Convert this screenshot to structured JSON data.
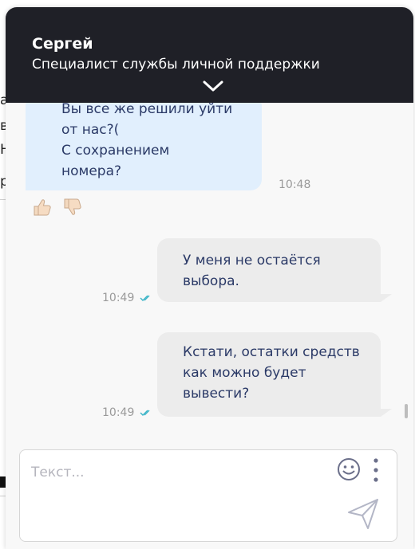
{
  "header": {
    "agent_name": "Сергей",
    "agent_role": "Специалист службы личной поддержки"
  },
  "background_page": {
    "fragments": [
      "а",
      "в",
      "Н",
      "р"
    ]
  },
  "messages": [
    {
      "direction": "incoming",
      "text": "Вы все же решили уйти\nот нас?(\nС сохранением\nномера?",
      "time": "10:48",
      "reactions": [
        "thumbs-up-icon",
        "thumbs-down-icon"
      ]
    },
    {
      "direction": "outgoing",
      "text": "У меня не остаётся\nвыбора.",
      "time": "10:49",
      "status": "read"
    },
    {
      "direction": "outgoing",
      "text": "Кстати, остатки средств\nкак можно будет\nвывести?",
      "time": "10:49",
      "status": "read"
    }
  ],
  "composer": {
    "placeholder": "Текст...",
    "value": ""
  },
  "colors": {
    "header_bg": "#1f2027",
    "incoming_bubble": "#e1effd",
    "outgoing_bubble": "#ececec",
    "message_text": "#2b3a67",
    "read_check": "#3bb4c7"
  }
}
